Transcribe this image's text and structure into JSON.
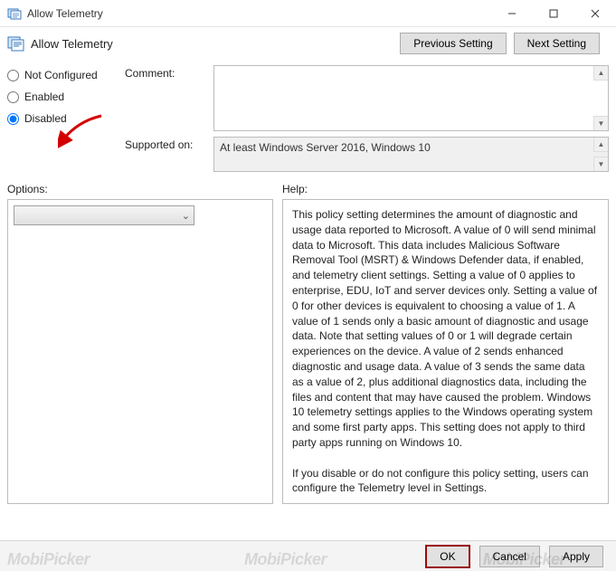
{
  "window": {
    "title": "Allow Telemetry"
  },
  "header": {
    "policy_name": "Allow Telemetry",
    "prev_btn": "Previous Setting",
    "next_btn": "Next Setting"
  },
  "radios": {
    "not_configured": "Not Configured",
    "enabled": "Enabled",
    "disabled": "Disabled",
    "selected": "disabled"
  },
  "fields": {
    "comment_label": "Comment:",
    "comment_value": "",
    "supported_label": "Supported on:",
    "supported_value": "At least Windows Server 2016, Windows 10"
  },
  "sections": {
    "options_label": "Options:",
    "help_label": "Help:"
  },
  "help_text": "This policy setting determines the amount of diagnostic and usage data reported to Microsoft. A value of 0 will send minimal data to Microsoft. This data includes Malicious Software Removal Tool (MSRT) & Windows Defender data, if enabled, and telemetry client settings. Setting a value of 0 applies to enterprise, EDU, IoT and server devices only. Setting a value of 0 for other devices is equivalent to choosing a value of 1. A value of 1 sends only a basic amount of diagnostic and usage data. Note that setting values of 0 or 1 will degrade certain experiences on the device. A value of 2 sends enhanced diagnostic and usage data. A value of 3 sends the same data as a value of 2, plus additional diagnostics data, including the files and content that may have caused the problem. Windows 10 telemetry settings applies to the Windows operating system and some first party apps. This setting does not apply to third party apps running on Windows 10.\n\nIf you disable or do not configure this policy setting, users can configure the Telemetry level in Settings.",
  "buttons": {
    "ok": "OK",
    "cancel": "Cancel",
    "apply": "Apply"
  },
  "watermark": "MobiPicker"
}
